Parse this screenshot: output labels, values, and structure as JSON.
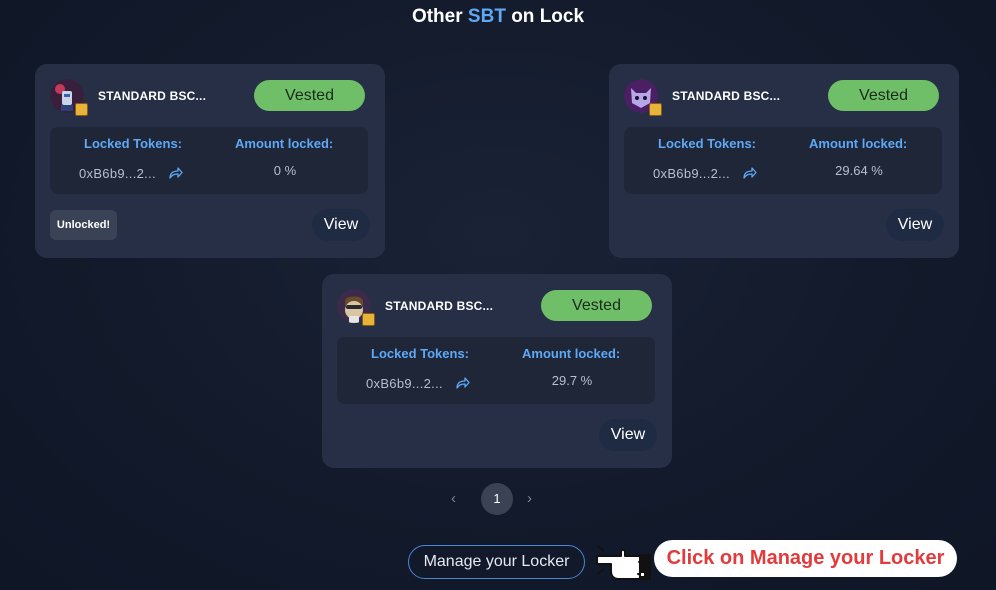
{
  "header": {
    "title_prefix": "Other",
    "title_accent": "SBT",
    "title_suffix": "on Lock"
  },
  "colors": {
    "accent": "#5fa8f5",
    "vested": "#6fbf69",
    "card": "#262f45",
    "callout_text": "#e23b3b"
  },
  "cards": [
    {
      "token_name": "STANDARD BSC...",
      "status": "Vested",
      "locked_tokens_label": "Locked Tokens:",
      "amount_locked_label": "Amount locked:",
      "address": "0xB6b9...2...",
      "amount_locked": "0 %",
      "unlocked_label": "Unlocked!",
      "view_label": "View",
      "avatar_icon": "robot-avatar-icon"
    },
    {
      "token_name": "STANDARD BSC...",
      "status": "Vested",
      "locked_tokens_label": "Locked Tokens:",
      "amount_locked_label": "Amount locked:",
      "address": "0xB6b9...2...",
      "amount_locked": "29.64 %",
      "view_label": "View",
      "avatar_icon": "cat-avatar-icon"
    },
    {
      "token_name": "STANDARD BSC...",
      "status": "Vested",
      "locked_tokens_label": "Locked Tokens:",
      "amount_locked_label": "Amount locked:",
      "address": "0xB6b9...2...",
      "amount_locked": "29.7 %",
      "view_label": "View",
      "avatar_icon": "ape-avatar-icon"
    }
  ],
  "pagination": {
    "prev": "‹",
    "current": "1",
    "next": "›"
  },
  "manage_button_label": "Manage your Locker",
  "callout_text": "Click on Manage your Locker"
}
